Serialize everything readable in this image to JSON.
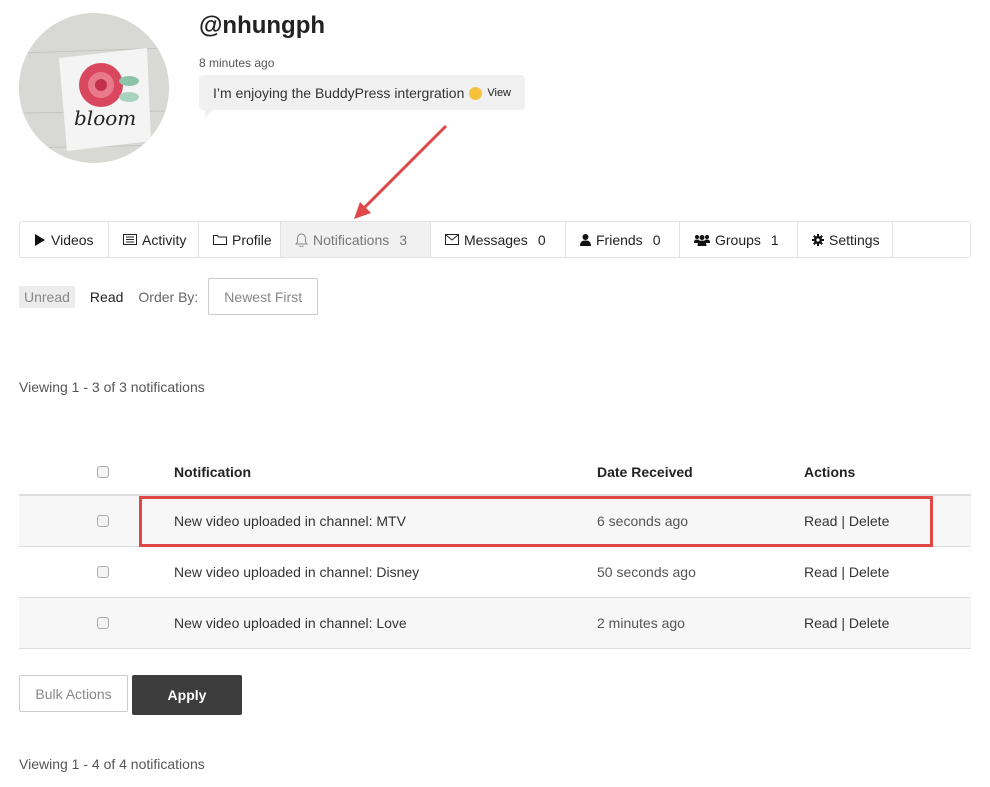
{
  "profile": {
    "username": "@nhungph",
    "last_active": "8 minutes ago",
    "status_text": "I’m enjoying the BuddyPress intergration",
    "view_link": "View",
    "avatar_text": "bloom"
  },
  "nav": {
    "tabs": [
      {
        "label": "Videos",
        "icon": "play-icon",
        "count": ""
      },
      {
        "label": "Activity",
        "icon": "list-icon",
        "count": ""
      },
      {
        "label": "Profile",
        "icon": "folder-icon",
        "count": ""
      },
      {
        "label": "Notifications",
        "icon": "bell-icon",
        "count": "3",
        "active": true
      },
      {
        "label": "Messages",
        "icon": "envelope-icon",
        "count": "0"
      },
      {
        "label": "Friends",
        "icon": "user-icon",
        "count": "0"
      },
      {
        "label": "Groups",
        "icon": "users-icon",
        "count": "1"
      },
      {
        "label": "Settings",
        "icon": "gear-icon",
        "count": ""
      }
    ]
  },
  "filter": {
    "unread": "Unread",
    "read": "Read",
    "order_label": "Order By:",
    "order_value": "Newest First"
  },
  "viewing_top": "Viewing 1 - 3 of 3 notifications",
  "table": {
    "headers": [
      "Notification",
      "Date Received",
      "Actions"
    ],
    "rows": [
      {
        "notification": "New video uploaded in channel: MTV",
        "date": "6 seconds ago",
        "read": "Read",
        "sep": " | ",
        "delete": "Delete"
      },
      {
        "notification": "New video uploaded in channel: Disney",
        "date": "50 seconds ago",
        "read": "Read",
        "sep": " | ",
        "delete": "Delete"
      },
      {
        "notification": "New video uploaded in channel: Love",
        "date": "2 minutes ago",
        "read": "Read",
        "sep": " | ",
        "delete": "Delete"
      }
    ]
  },
  "bulk": {
    "select": "Bulk Actions",
    "apply": "Apply"
  },
  "viewing_bottom": "Viewing 1 - 4 of 4 notifications",
  "colors": {
    "annotation": "#e04848",
    "apply_bg": "#3d3d3d",
    "active_tab_bg": "#f1f1f1"
  }
}
